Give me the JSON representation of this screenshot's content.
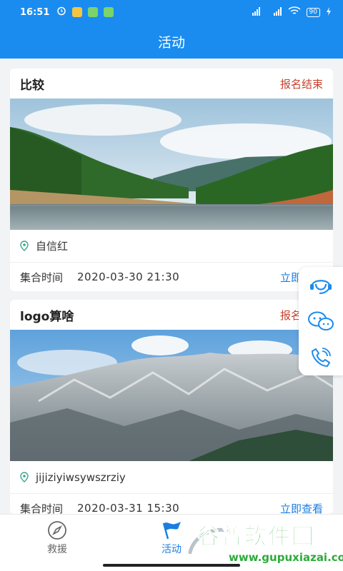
{
  "status_bar": {
    "time": "16:51",
    "battery": "90"
  },
  "header": {
    "title": "活动"
  },
  "activities": [
    {
      "title": "比较",
      "status": "报名结束",
      "location": "自信红",
      "time_label": "集合时间",
      "time_value": "2020-03-30 21:30",
      "action": "立即查看"
    },
    {
      "title": "logo算啥",
      "status": "报名结束",
      "location": "jijiziyiwsywszrziy",
      "time_label": "集合时间",
      "time_value": "2020-03-31 15:30",
      "action": "立即查看"
    }
  ],
  "float_actions": [
    {
      "icon": "customer-service-icon"
    },
    {
      "icon": "wechat-icon"
    },
    {
      "icon": "phone-icon"
    }
  ],
  "tabs": [
    {
      "label": "救援",
      "icon": "compass-icon",
      "active": false
    },
    {
      "label": "活动",
      "icon": "flag-icon",
      "active": true
    }
  ],
  "watermark": {
    "title": "谷普软件园",
    "url": "www.gupuxiazai.com"
  },
  "colors": {
    "primary": "#1a8cf0",
    "status_red": "#c8432f",
    "link_blue": "#1a7ee0",
    "watermark_green": "#2eaa3c"
  }
}
